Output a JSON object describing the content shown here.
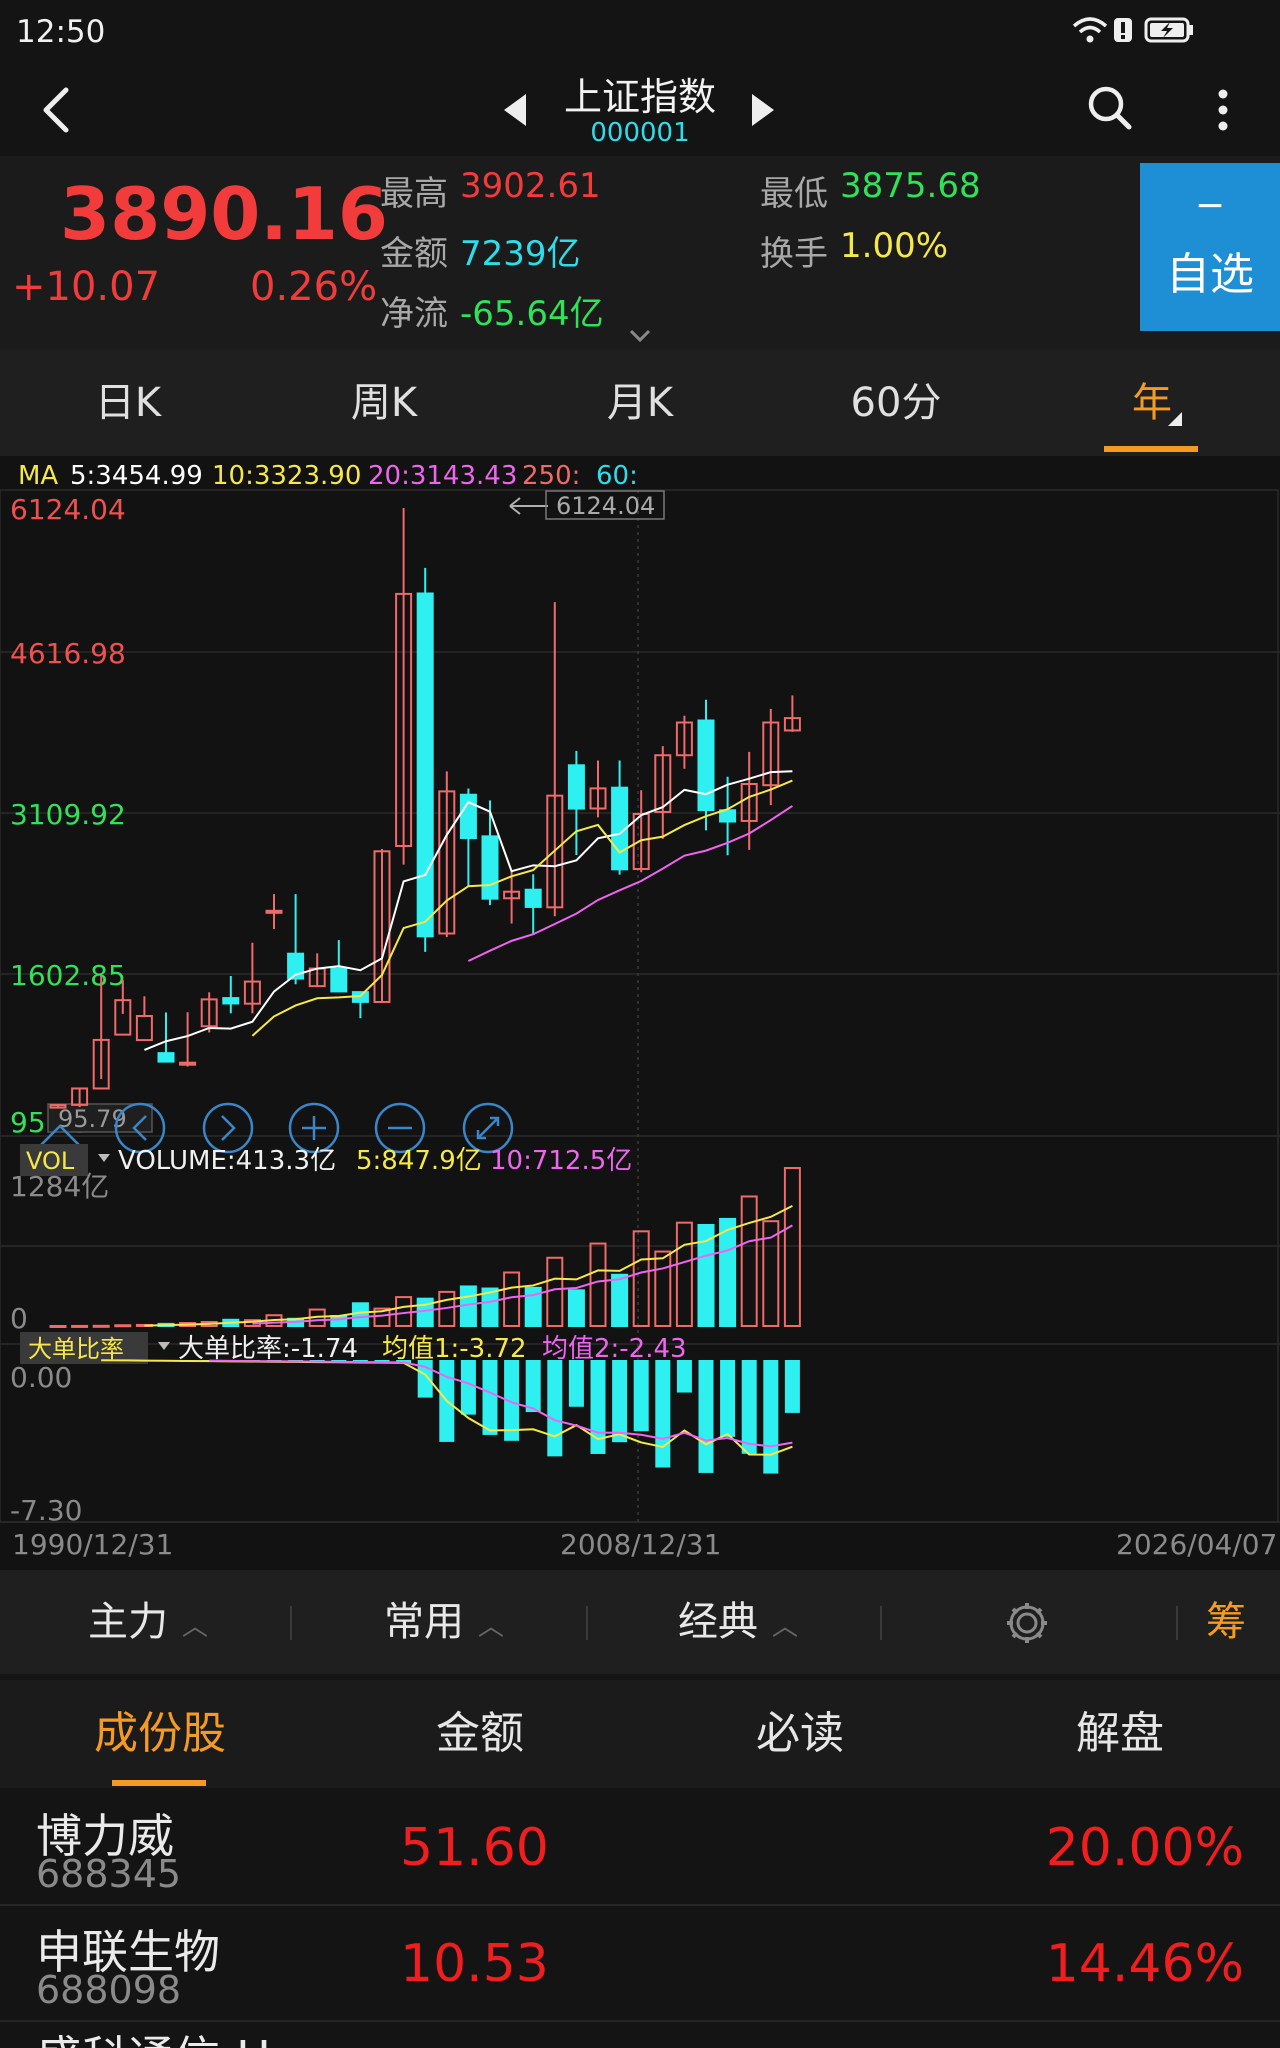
{
  "status": {
    "time": "12:50"
  },
  "header": {
    "title": "上证指数",
    "code": "000001"
  },
  "quote": {
    "price": "3890.16",
    "change": "+10.07",
    "change_pct": "0.26%",
    "high_label": "最高",
    "high": "3902.61",
    "low_label": "最低",
    "low": "3875.68",
    "amount_label": "金额",
    "amount": "7239亿",
    "turnover_label": "换手",
    "turnover": "1.00%",
    "netflow_label": "净流",
    "netflow": "-65.64亿"
  },
  "favorite": {
    "icon": "−",
    "label": "自选"
  },
  "periods": [
    "日K",
    "周K",
    "月K",
    "60分",
    "年"
  ],
  "active_period": 4,
  "ma_legend": {
    "prefix": "MA",
    "ma5": "5:3454.99",
    "ma10": "10:3323.90",
    "ma20": "20:3143.43",
    "ma250": "250:",
    "ma60": "60:"
  },
  "price_axis": [
    "6124.04",
    "4616.98",
    "3109.92",
    "1602.85",
    "95.79"
  ],
  "max_marker": "6124.04",
  "min_marker": "95.79",
  "volume_legend": {
    "tag": "VOL",
    "vol": "VOLUME:413.3亿",
    "ma5": "5:847.9亿",
    "ma10": "10:712.5亿"
  },
  "volume_axis": [
    "1284亿",
    "0"
  ],
  "ratio_legend": {
    "tag": "大单比率",
    "val": "大单比率:-1.74",
    "avg1": "均值1:-3.72",
    "avg2": "均值2:-2.43"
  },
  "ratio_axis": [
    "0.00",
    "-7.30"
  ],
  "date_axis": [
    "1990/12/31",
    "2008/12/31",
    "2026/04/07"
  ],
  "toolbar": [
    "主力",
    "常用",
    "经典",
    "筹"
  ],
  "lower_tabs": [
    "成份股",
    "金额",
    "必读",
    "解盘"
  ],
  "stocks": [
    {
      "name": "博力威",
      "code": "688345",
      "price": "51.60",
      "pct": "20.00%"
    },
    {
      "name": "申联生物",
      "code": "688098",
      "price": "10.53",
      "pct": "14.46%"
    },
    {
      "name": "盛科通信-U",
      "code": "",
      "price": "",
      "pct": ""
    }
  ],
  "colors": {
    "up": "#f06a6a",
    "down": "#2ff0f0",
    "ma5": "#ffffff",
    "ma10": "#f5e84a",
    "ma20": "#ee66ee",
    "accent": "#f59a23",
    "fav_bg": "#1e8fd4"
  },
  "chart_data": {
    "type": "candlestick",
    "x_range": [
      "1990/12/31",
      "2026/04/07"
    ],
    "ylim": [
      95.79,
      6124.04
    ],
    "candles": [
      [
        100,
        125,
        95.79,
        127.61
      ],
      [
        127,
        292,
        105,
        292.75
      ],
      [
        292,
        780,
        386,
        1429
      ],
      [
        833,
        1179,
        1041,
        1381
      ],
      [
        778,
        1020,
        1024,
        1218
      ],
      [
        647,
        562,
        556,
        1056
      ],
      [
        538,
        551,
        512,
        1058
      ],
      [
        917,
        1187,
        855,
        1258
      ],
      [
        1200,
        1146,
        1047,
        1422
      ],
      [
        1144,
        1366,
        1047,
        1756
      ],
      [
        2073,
        2077,
        1894,
        2245
      ],
      [
        1646,
        1396,
        1339,
        2245
      ],
      [
        1320,
        1497,
        1311,
        1649
      ],
      [
        1497,
        1267,
        1259,
        1783
      ],
      [
        1260,
        1162,
        998,
        1266
      ],
      [
        1161,
        2675,
        1161,
        2698
      ],
      [
        2728,
        5261,
        2541,
        6124
      ],
      [
        5265,
        1821,
        1664,
        5522
      ],
      [
        1849,
        3277,
        1814,
        3478
      ],
      [
        3243,
        2808,
        2319,
        3306
      ],
      [
        2825,
        2199,
        2134,
        3186
      ],
      [
        2203,
        2269,
        1949,
        2478
      ],
      [
        2289,
        2116,
        1849,
        2444
      ],
      [
        2112,
        3234,
        2022,
        5178
      ],
      [
        3539,
        3104,
        2638,
        3684
      ],
      [
        3105,
        3307,
        3016,
        3587
      ],
      [
        3314,
        2494,
        2440,
        3587
      ],
      [
        2497,
        3050,
        2464,
        3288
      ],
      [
        3070,
        3640,
        2800,
        3731
      ],
      [
        3640,
        3969,
        3504,
        4037
      ],
      [
        3989,
        3089,
        2885,
        4198
      ],
      [
        3087,
        2974,
        2635,
        3424
      ],
      [
        2980,
        3351,
        2689,
        3674
      ],
      [
        3339,
        3969,
        3139,
        4106
      ],
      [
        3889,
        4013,
        3875,
        4241
      ]
    ],
    "volume_max": "1284亿",
    "ratio_range": [
      -7.3,
      0.0
    ]
  }
}
